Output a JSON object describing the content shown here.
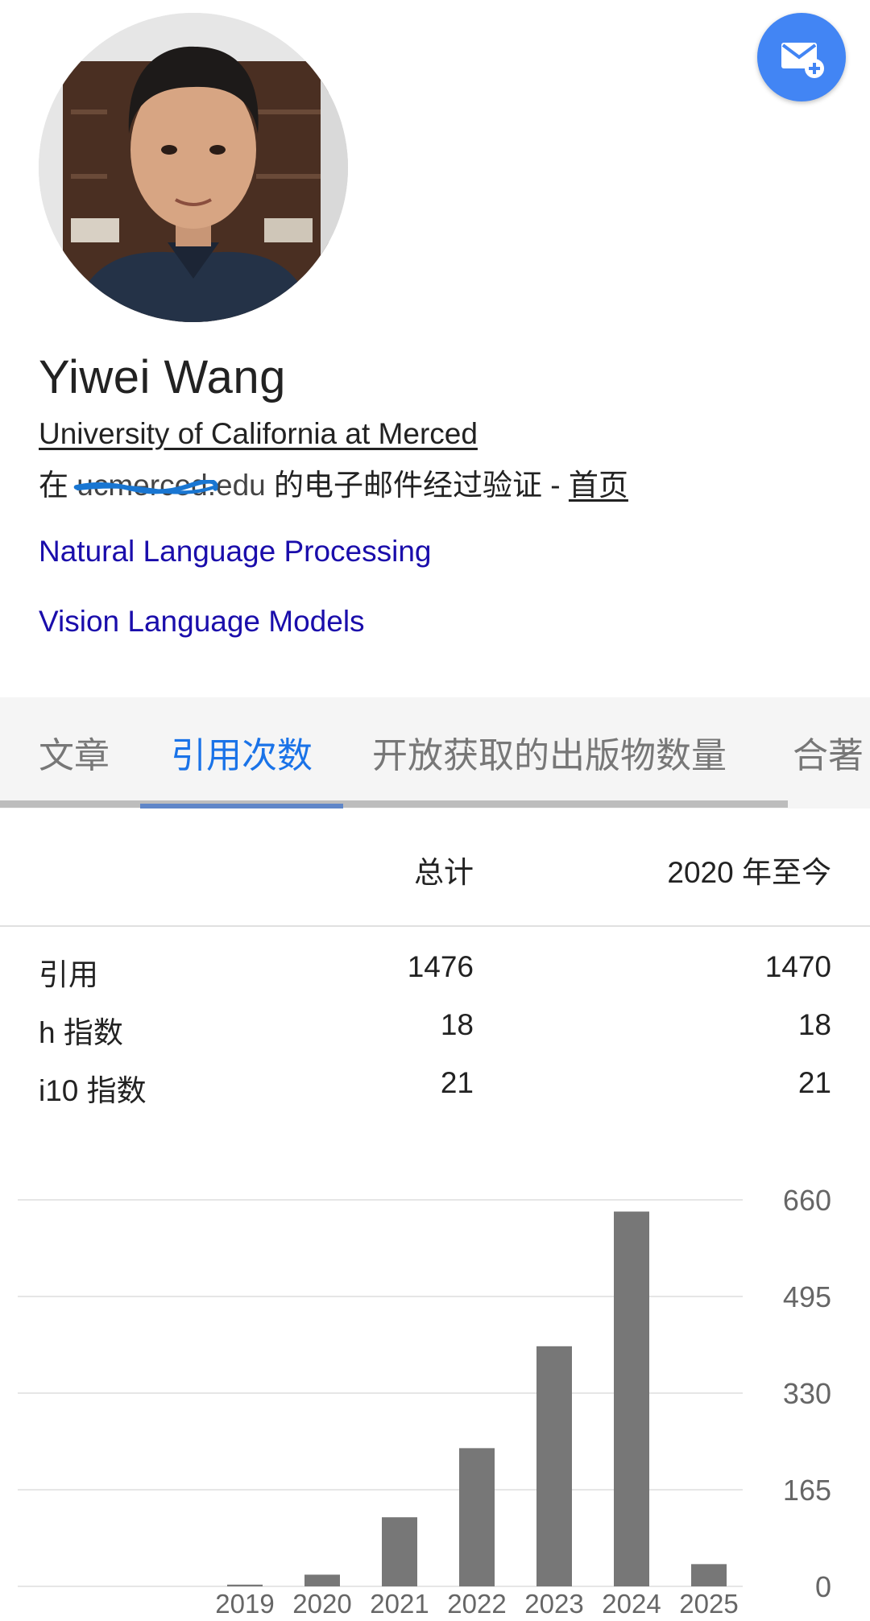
{
  "profile": {
    "name": "Yiwei Wang",
    "affiliation": "University of California at Merced",
    "verify_prefix": "在",
    "verify_domain": "ucmerced.edu",
    "verify_suffix": " 的电子邮件经过验证 - ",
    "homepage_label": "首页",
    "interests": [
      "Natural Language Processing",
      "Vision Language Models"
    ]
  },
  "tabs": [
    "文章",
    "引用次数",
    "开放获取的出版物数量",
    "合著"
  ],
  "active_tab": 1,
  "stats": {
    "headers": [
      "总计",
      "2020 年至今"
    ],
    "rows": [
      {
        "label": "引用",
        "total": "1476",
        "since": "1470"
      },
      {
        "label": "h 指数",
        "total": "18",
        "since": "18"
      },
      {
        "label": "i10 指数",
        "total": "21",
        "since": "21"
      }
    ]
  },
  "icons": {
    "follow": "email-add-icon",
    "avatar": "profile-photo"
  },
  "colors": {
    "accent": "#1a73e8",
    "fab": "#4285f4",
    "link": "#1a0dab",
    "bar": "#777777",
    "scribble": "#1976d2"
  },
  "chart_data": {
    "type": "bar",
    "categories": [
      "2019",
      "2020",
      "2021",
      "2022",
      "2023",
      "2024",
      "2025"
    ],
    "values": [
      3,
      20,
      118,
      236,
      410,
      640,
      38
    ],
    "ylim": [
      0,
      660
    ],
    "yticks": [
      0,
      165,
      330,
      495,
      660
    ],
    "y_axis_side": "right",
    "grid": true,
    "title": "",
    "xlabel": "",
    "ylabel": ""
  }
}
